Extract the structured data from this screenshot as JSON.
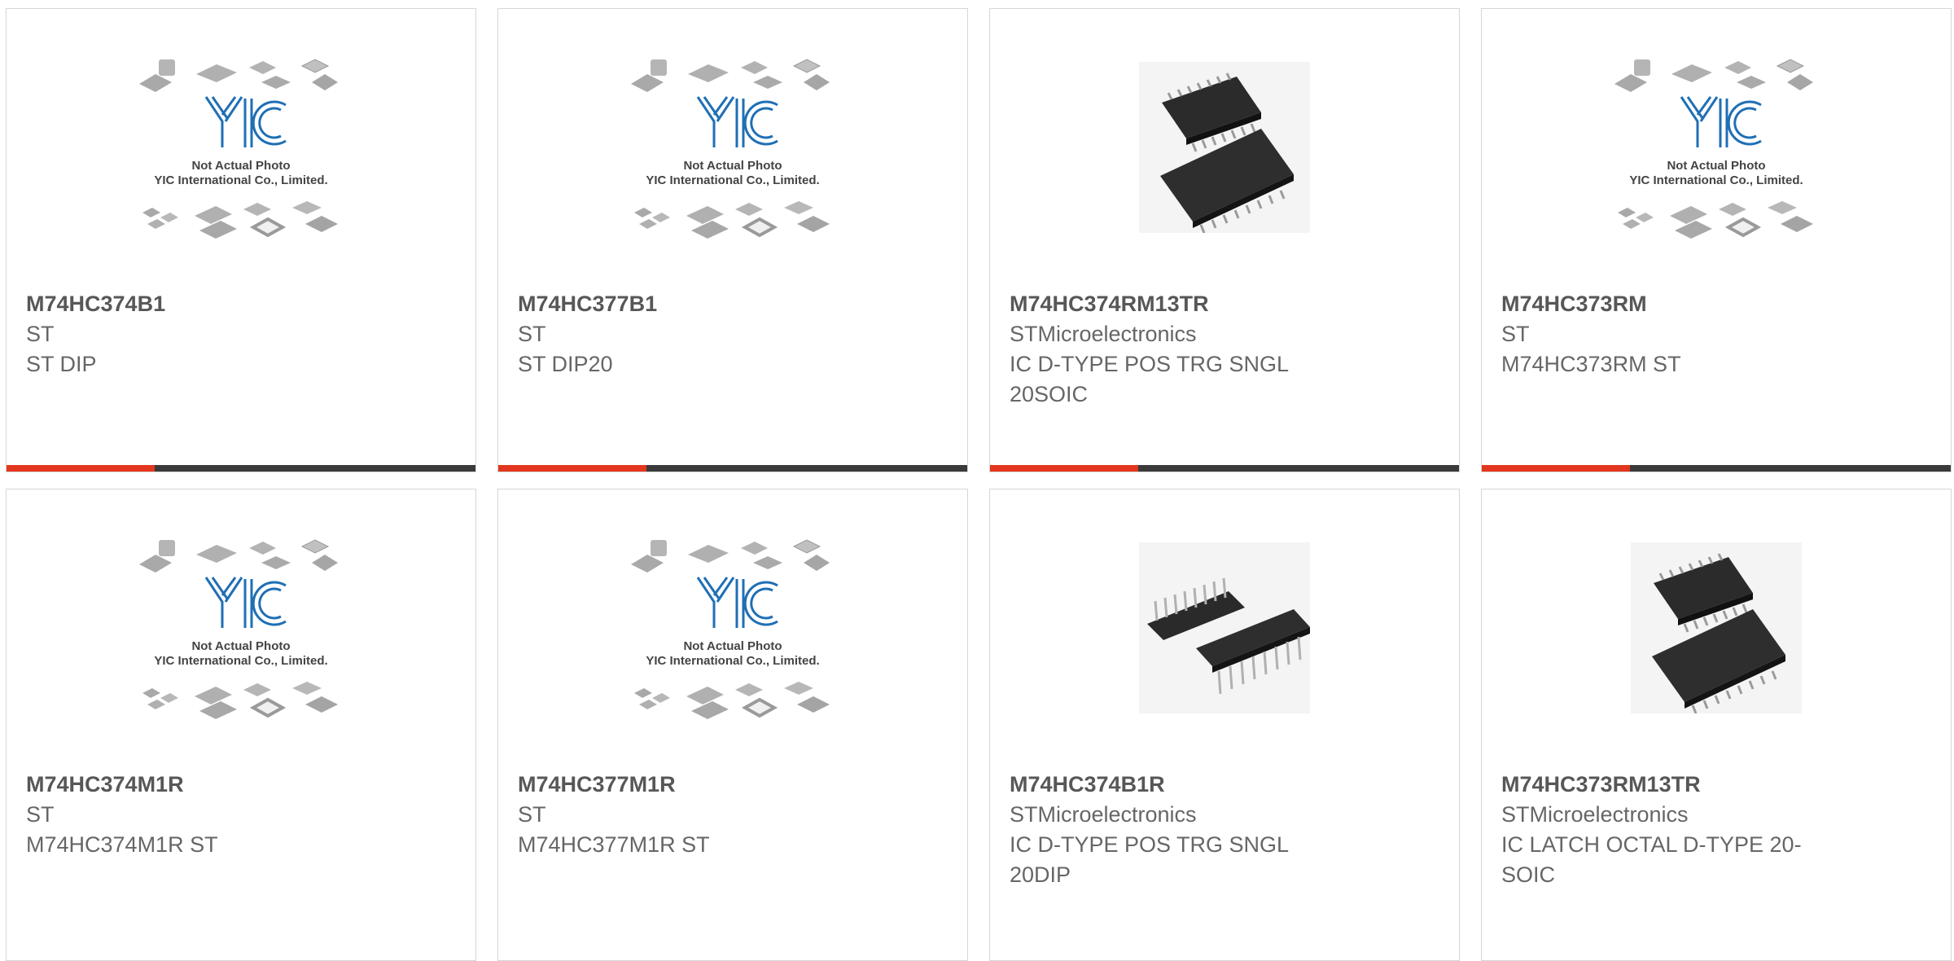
{
  "colors": {
    "accent": "#e3361e",
    "bar": "#3a3a3a",
    "logo_blue": "#1f6fb5"
  },
  "placeholder": {
    "line1": "Not Actual Photo",
    "line2": "YIC International Co., Limited."
  },
  "products": [
    {
      "part": "M74HC374B1",
      "maker": "ST",
      "desc": "ST DIP",
      "image": "placeholder-icon"
    },
    {
      "part": "M74HC377B1",
      "maker": "ST",
      "desc": "ST DIP20",
      "image": "placeholder-icon"
    },
    {
      "part": "M74HC374RM13TR",
      "maker": "STMicroelectronics",
      "desc": "IC D-TYPE POS TRG SNGL 20SOIC",
      "image": "soic-chip-icon"
    },
    {
      "part": "M74HC373RM",
      "maker": "ST",
      "desc": "M74HC373RM ST",
      "image": "placeholder-icon"
    },
    {
      "part": "M74HC374M1R",
      "maker": "ST",
      "desc": "M74HC374M1R ST",
      "image": "placeholder-icon"
    },
    {
      "part": "M74HC377M1R",
      "maker": "ST",
      "desc": "M74HC377M1R ST",
      "image": "placeholder-icon"
    },
    {
      "part": "M74HC374B1R",
      "maker": "STMicroelectronics",
      "desc": "IC D-TYPE POS TRG SNGL 20DIP",
      "image": "dip-chip-icon"
    },
    {
      "part": "M74HC373RM13TR",
      "maker": "STMicroelectronics",
      "desc": "IC LATCH OCTAL D-TYPE 20-SOIC",
      "image": "soic-chip-icon"
    }
  ]
}
